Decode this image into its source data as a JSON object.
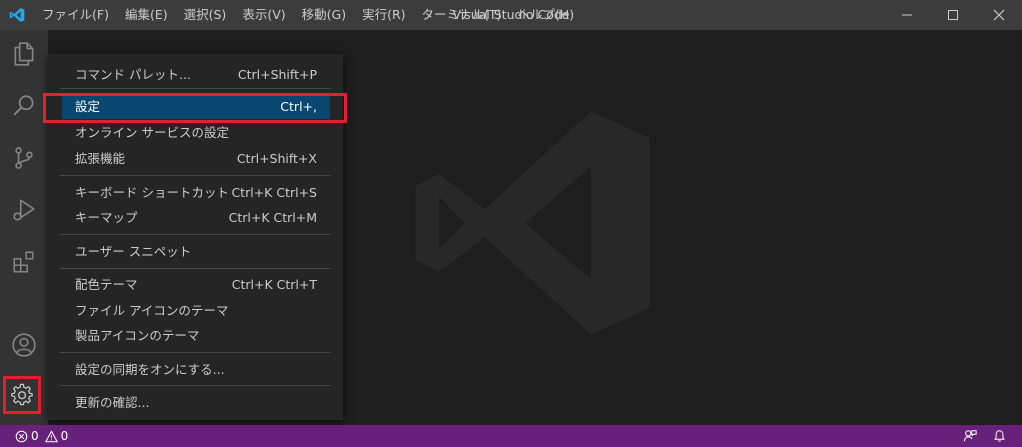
{
  "window": {
    "title": "Visual Studio Code"
  },
  "menubar": [
    {
      "label": "ファイル(F)"
    },
    {
      "label": "編集(E)"
    },
    {
      "label": "選択(S)"
    },
    {
      "label": "表示(V)"
    },
    {
      "label": "移動(G)"
    },
    {
      "label": "実行(R)"
    },
    {
      "label": "ターミナル(T)"
    },
    {
      "label": "ヘルプ(H)"
    }
  ],
  "activitybar": {
    "icons": [
      "explorer-icon",
      "search-icon",
      "source-control-icon",
      "run-debug-icon",
      "extensions-icon",
      "account-icon",
      "gear-icon"
    ],
    "highlighted": "gear-icon"
  },
  "context_menu": {
    "items": [
      {
        "label": "コマンド パレット...",
        "shortcut": "Ctrl+Shift+P"
      },
      {
        "label": "設定",
        "shortcut": "Ctrl+,",
        "selected": true
      },
      {
        "label": "オンライン サービスの設定",
        "shortcut": ""
      },
      {
        "label": "拡張機能",
        "shortcut": "Ctrl+Shift+X"
      },
      {
        "label": "キーボード ショートカット",
        "shortcut": "Ctrl+K Ctrl+S"
      },
      {
        "label": "キーマップ",
        "shortcut": "Ctrl+K Ctrl+M"
      },
      {
        "label": "ユーザー スニペット",
        "shortcut": ""
      },
      {
        "label": "配色テーマ",
        "shortcut": "Ctrl+K Ctrl+T"
      },
      {
        "label": "ファイル アイコンのテーマ",
        "shortcut": ""
      },
      {
        "label": "製品アイコンのテーマ",
        "shortcut": ""
      },
      {
        "label": "設定の同期をオンにする...",
        "shortcut": ""
      },
      {
        "label": "更新の確認...",
        "shortcut": ""
      }
    ]
  },
  "statusbar": {
    "errors": "0",
    "warnings": "0"
  },
  "colors": {
    "titlebar": "#3c3c3c",
    "activitybar": "#333333",
    "editor": "#1e1e1e",
    "menu": "#252526",
    "menu_selected": "#094771",
    "statusbar": "#68217a",
    "highlight_frame": "#e0212f",
    "brand": "#23a9f2"
  }
}
